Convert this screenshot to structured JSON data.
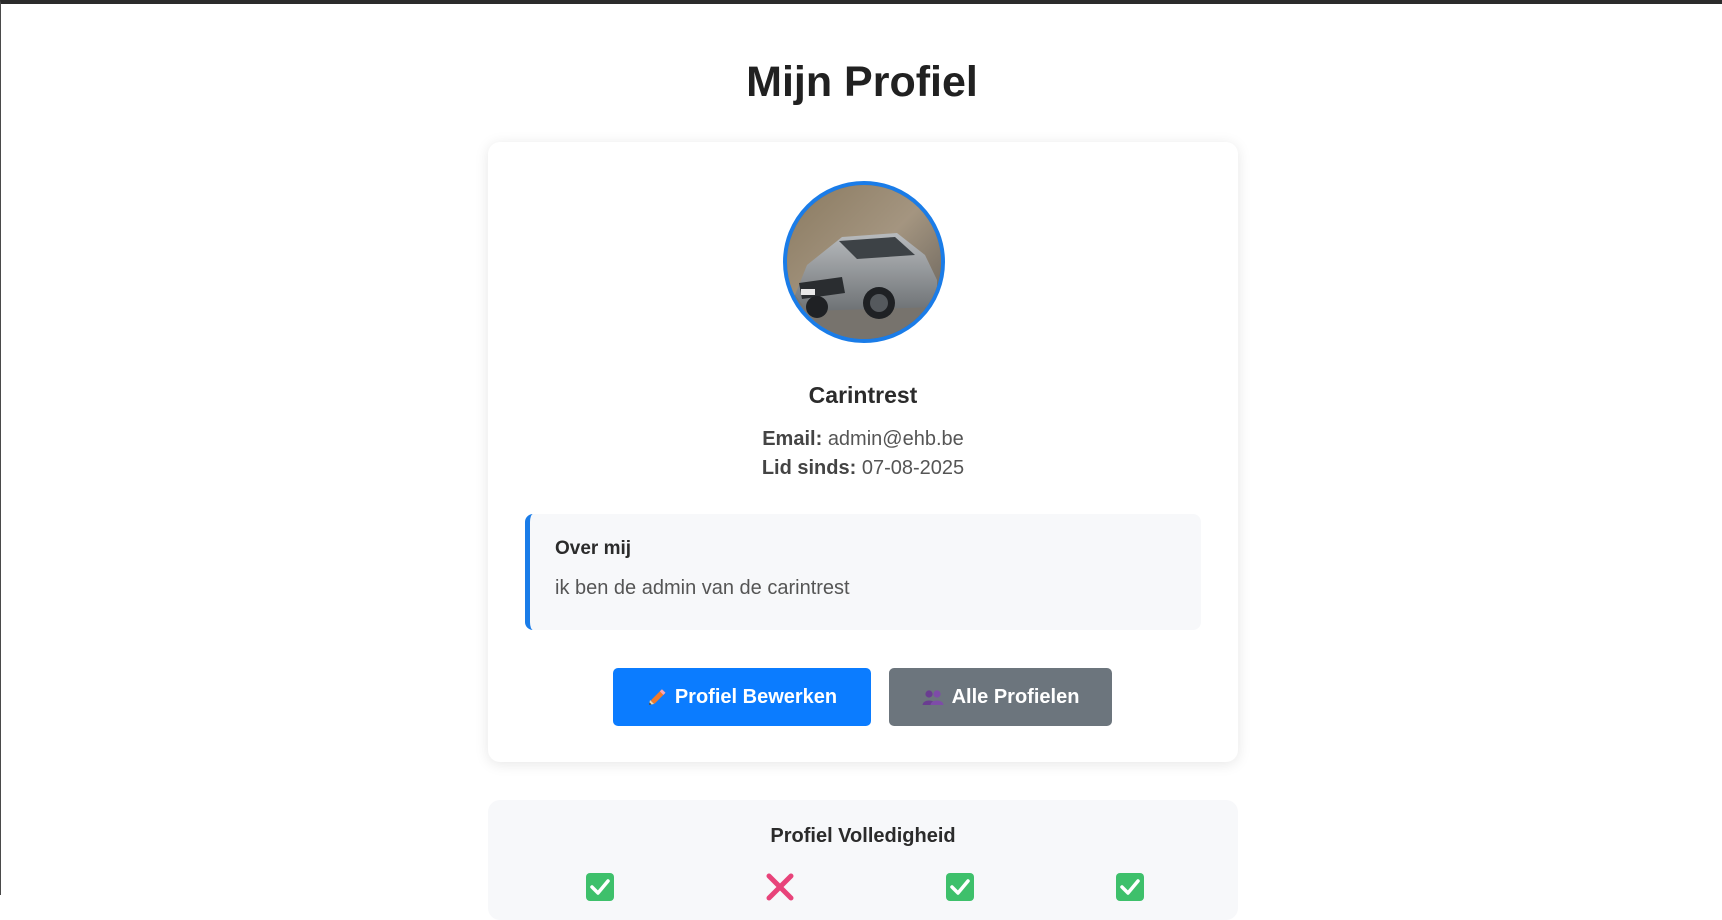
{
  "page": {
    "title": "Mijn Profiel"
  },
  "profile": {
    "avatar_alt": "profile photo: grey sports car",
    "username": "Carintrest",
    "email_label": "Email:",
    "email": "admin@ehb.be",
    "member_since_label": "Lid sinds:",
    "member_since": "07-08-2025",
    "about": {
      "title": "Over mij",
      "text": "ik ben de admin van de carintrest"
    }
  },
  "actions": {
    "edit_label": "Profiel Bewerken",
    "edit_icon": "pencil-icon",
    "all_profiles_label": "Alle Profielen",
    "all_profiles_icon": "users-icon"
  },
  "completeness": {
    "title": "Profiel Volledigheid",
    "items": [
      {
        "status": "complete",
        "icon": "check-icon"
      },
      {
        "status": "incomplete",
        "icon": "cross-icon"
      },
      {
        "status": "complete",
        "icon": "check-icon"
      },
      {
        "status": "complete",
        "icon": "check-icon"
      }
    ]
  },
  "colors": {
    "accent": "#1a7ce8",
    "primary_button": "#0b7cff",
    "secondary_button": "#6c757d",
    "check": "#3ec06b",
    "cross": "#e8437a"
  }
}
